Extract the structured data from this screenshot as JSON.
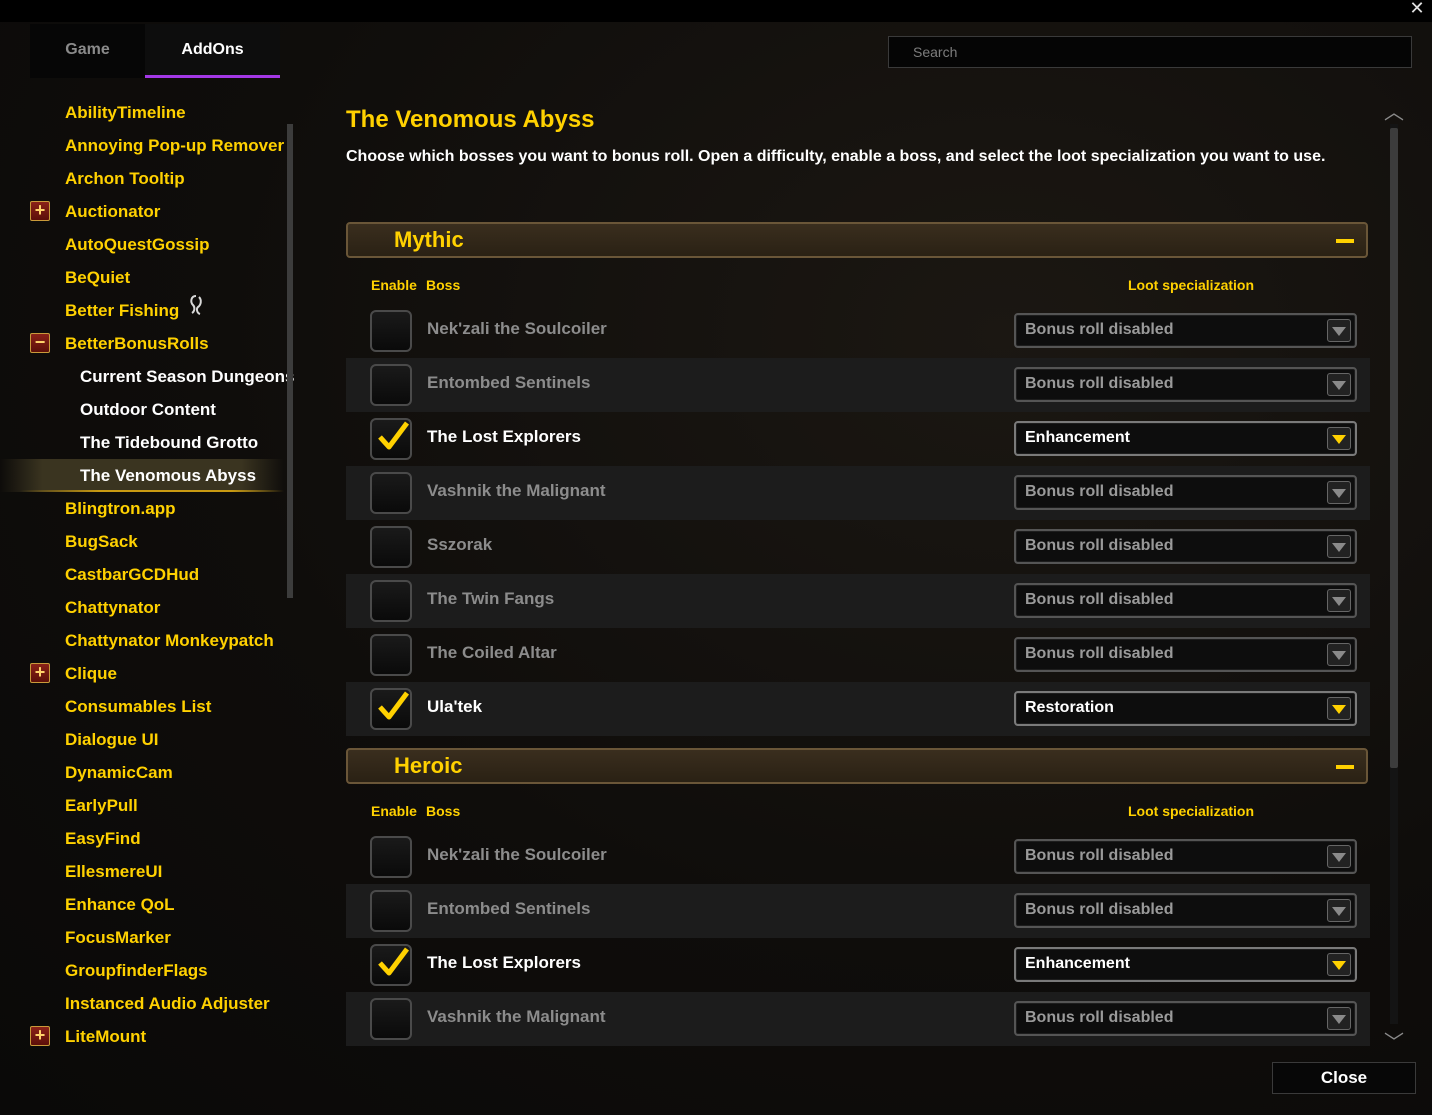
{
  "window": {
    "close_glyph": "✕"
  },
  "tabs": [
    {
      "label": "Game",
      "active": false
    },
    {
      "label": "AddOns",
      "active": true
    }
  ],
  "search": {
    "placeholder": "Search"
  },
  "sidebar": {
    "items": [
      {
        "label": "AbilityTimeline"
      },
      {
        "label": "Annoying Pop-up Remover"
      },
      {
        "label": "Archon Tooltip"
      },
      {
        "label": "Auctionator",
        "expander": "+"
      },
      {
        "label": "AutoQuestGossip"
      },
      {
        "label": "BeQuiet"
      },
      {
        "label": "Better Fishing",
        "icon": "fishing-hook-icon"
      },
      {
        "label": "BetterBonusRolls",
        "expander": "−"
      },
      {
        "label": "Current Season Dungeons",
        "child": true
      },
      {
        "label": "Outdoor Content",
        "child": true
      },
      {
        "label": "The Tidebound Grotto",
        "child": true
      },
      {
        "label": "The Venomous Abyss",
        "child": true,
        "selected": true
      },
      {
        "label": "Blingtron.app"
      },
      {
        "label": "BugSack"
      },
      {
        "label": "CastbarGCDHud"
      },
      {
        "label": "Chattynator"
      },
      {
        "label": "Chattynator Monkeypatch"
      },
      {
        "label": "Clique",
        "expander": "+"
      },
      {
        "label": "Consumables List"
      },
      {
        "label": "Dialogue UI"
      },
      {
        "label": "DynamicCam"
      },
      {
        "label": "EarlyPull"
      },
      {
        "label": "EasyFind"
      },
      {
        "label": "EllesmereUI"
      },
      {
        "label": "Enhance QoL"
      },
      {
        "label": "FocusMarker"
      },
      {
        "label": "GroupfinderFlags"
      },
      {
        "label": "Instanced Audio Adjuster"
      },
      {
        "label": "LiteMount",
        "expander": "+"
      }
    ]
  },
  "main": {
    "title": "The Venomous Abyss",
    "description": "Choose which bosses you want to bonus roll. Open a difficulty, enable a boss, and select the loot specialization you want to use.",
    "columns": {
      "enable": "Enable",
      "boss": "Boss",
      "loot": "Loot specialization"
    },
    "sections": [
      {
        "title": "Mythic",
        "rows": [
          {
            "boss": "Nek'zali the Soulcoiler",
            "enabled": false,
            "loot": "Bonus roll disabled"
          },
          {
            "boss": "Entombed Sentinels",
            "enabled": false,
            "loot": "Bonus roll disabled"
          },
          {
            "boss": "The Lost Explorers",
            "enabled": true,
            "loot": "Enhancement"
          },
          {
            "boss": "Vashnik the Malignant",
            "enabled": false,
            "loot": "Bonus roll disabled"
          },
          {
            "boss": "Sszorak",
            "enabled": false,
            "loot": "Bonus roll disabled"
          },
          {
            "boss": "The Twin Fangs",
            "enabled": false,
            "loot": "Bonus roll disabled"
          },
          {
            "boss": "The Coiled Altar",
            "enabled": false,
            "loot": "Bonus roll disabled"
          },
          {
            "boss": "Ula'tek",
            "enabled": true,
            "loot": "Restoration"
          }
        ]
      },
      {
        "title": "Heroic",
        "rows": [
          {
            "boss": "Nek'zali the Soulcoiler",
            "enabled": false,
            "loot": "Bonus roll disabled"
          },
          {
            "boss": "Entombed Sentinels",
            "enabled": false,
            "loot": "Bonus roll disabled"
          },
          {
            "boss": "The Lost Explorers",
            "enabled": true,
            "loot": "Enhancement"
          },
          {
            "boss": "Vashnik the Malignant",
            "enabled": false,
            "loot": "Bonus roll disabled"
          }
        ]
      }
    ]
  },
  "footer": {
    "close_label": "Close"
  },
  "colors": {
    "gold": "#ffd100",
    "tab_accent": "#a338e6",
    "dim_text": "#8c8c8c"
  }
}
